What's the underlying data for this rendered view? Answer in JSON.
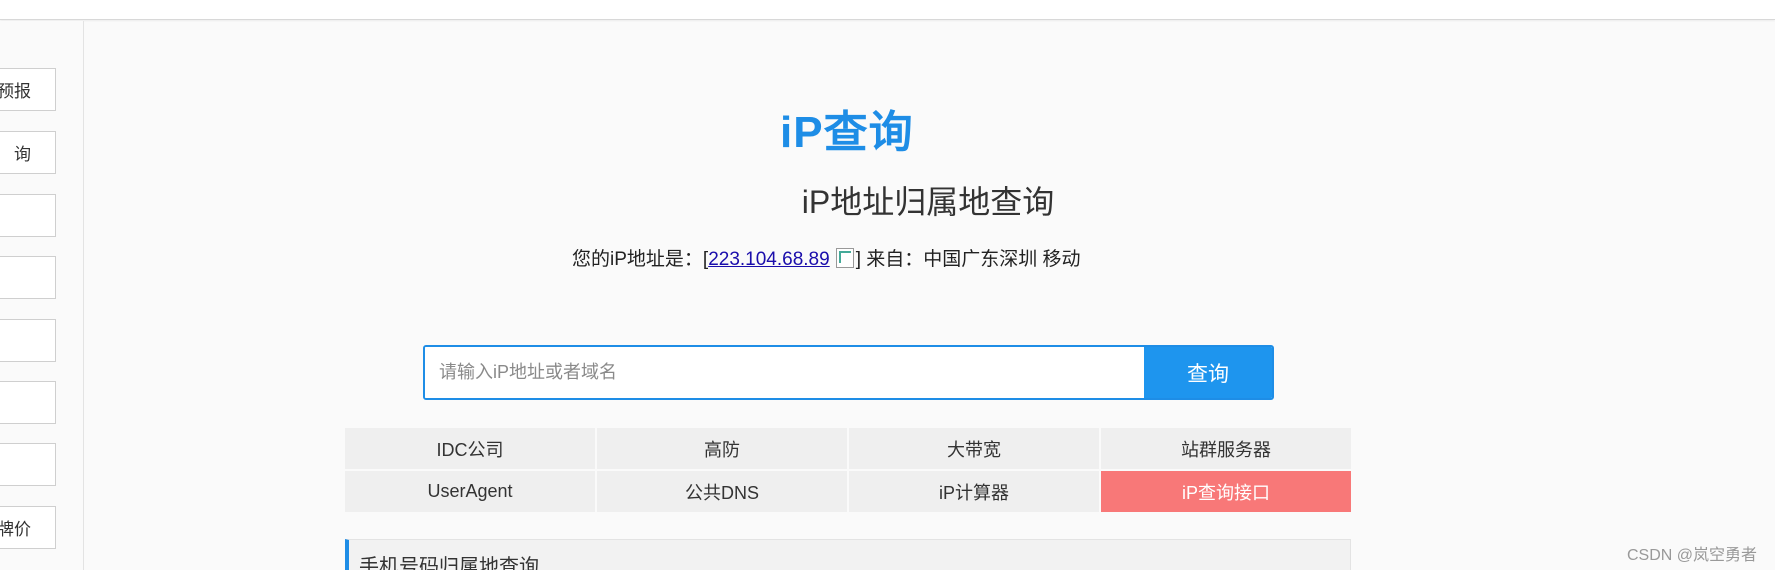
{
  "sidebar": {
    "items": [
      {
        "label": "预报"
      },
      {
        "label": "询"
      },
      {
        "label": ""
      },
      {
        "label": ""
      },
      {
        "label": ""
      },
      {
        "label": ""
      },
      {
        "label": ""
      },
      {
        "label": "牌价"
      }
    ]
  },
  "logo": {
    "text": "iP查询"
  },
  "page": {
    "title": "iP地址归属地查询"
  },
  "ip_info": {
    "prefix": "您的iP地址是：[",
    "ip": "223.104.68.89",
    "suffix": "] 来自：中国广东深圳 移动"
  },
  "search": {
    "placeholder": "请输入iP地址或者域名",
    "value": "",
    "button_label": "查询"
  },
  "quick_links": [
    {
      "label": "IDC公司"
    },
    {
      "label": "高防"
    },
    {
      "label": "大带宽"
    },
    {
      "label": "站群服务器"
    },
    {
      "label": "UserAgent"
    },
    {
      "label": "公共DNS"
    },
    {
      "label": "iP计算器"
    },
    {
      "label": "iP查询接口"
    }
  ],
  "section": {
    "title": "手机号码归属地查询"
  },
  "watermark": "CSDN @岚空勇者",
  "colors": {
    "accent": "#1e8de6",
    "highlight": "#f87878"
  }
}
